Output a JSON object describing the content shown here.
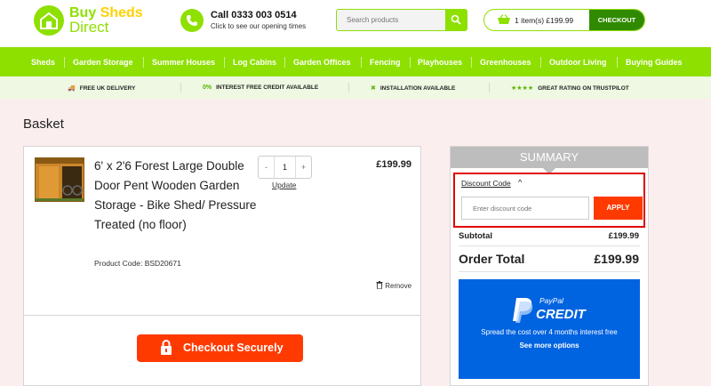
{
  "header": {
    "logo": {
      "word1": "Buy",
      "word2": "Sheds",
      "word3": "Direct"
    },
    "phone": {
      "number": "Call 0333 003 0514",
      "subtext": "Click to see our opening times"
    },
    "search": {
      "placeholder": "Search products"
    },
    "cart": {
      "summary": "1 item(s)  £199.99",
      "checkout_label": "CHECKOUT"
    }
  },
  "nav": {
    "items": [
      "Sheds",
      "Garden Storage",
      "Summer Houses",
      "Log Cabins",
      "Garden Offices",
      "Fencing",
      "Playhouses",
      "Greenhouses",
      "Outdoor Living",
      "Buying Guides"
    ]
  },
  "usp": {
    "items": [
      {
        "icon": "truck-icon",
        "glyph": "🚚",
        "text": "FREE UK DELIVERY"
      },
      {
        "icon": "percent-icon",
        "glyph": "0%",
        "text": "INTEREST FREE CREDIT AVAILABLE"
      },
      {
        "icon": "tools-icon",
        "glyph": "✖",
        "text": "INSTALLATION AVAILABLE"
      },
      {
        "icon": "stars-icon",
        "glyph": "★★★★",
        "text": "GREAT RATING ON TRUSTPILOT"
      }
    ]
  },
  "page": {
    "title": "Basket"
  },
  "basket": {
    "item": {
      "name": "6' x 2'6 Forest Large Double Door Pent Wooden Garden Storage - Bike Shed/ Pressure Treated (no floor)",
      "code": "Product Code: BSD20671",
      "quantity": "1",
      "minus": "-",
      "plus": "+",
      "update_label": "Update",
      "price": "£199.99",
      "remove_label": "Remove"
    },
    "checkout_label": "Checkout Securely"
  },
  "summary": {
    "title": "SUMMARY",
    "discount_label": "Discount Code",
    "discount_caret": "^",
    "discount_placeholder": "Enter discount code",
    "apply_label": "APPLY",
    "subtotal_label": "Subtotal",
    "subtotal_value": "£199.99",
    "total_label": "Order Total",
    "total_value": "£199.99",
    "paypal": {
      "name": "PayPal",
      "credit": "CREDIT",
      "spread": "Spread the cost over 4 months interest free",
      "more": "See more options"
    }
  },
  "colors": {
    "brand_green": "#8ee000",
    "dark_green": "#2f8a00",
    "accent_orange": "#ff3a00",
    "highlight_red": "#e10000",
    "paypal_blue": "#0063e0"
  }
}
